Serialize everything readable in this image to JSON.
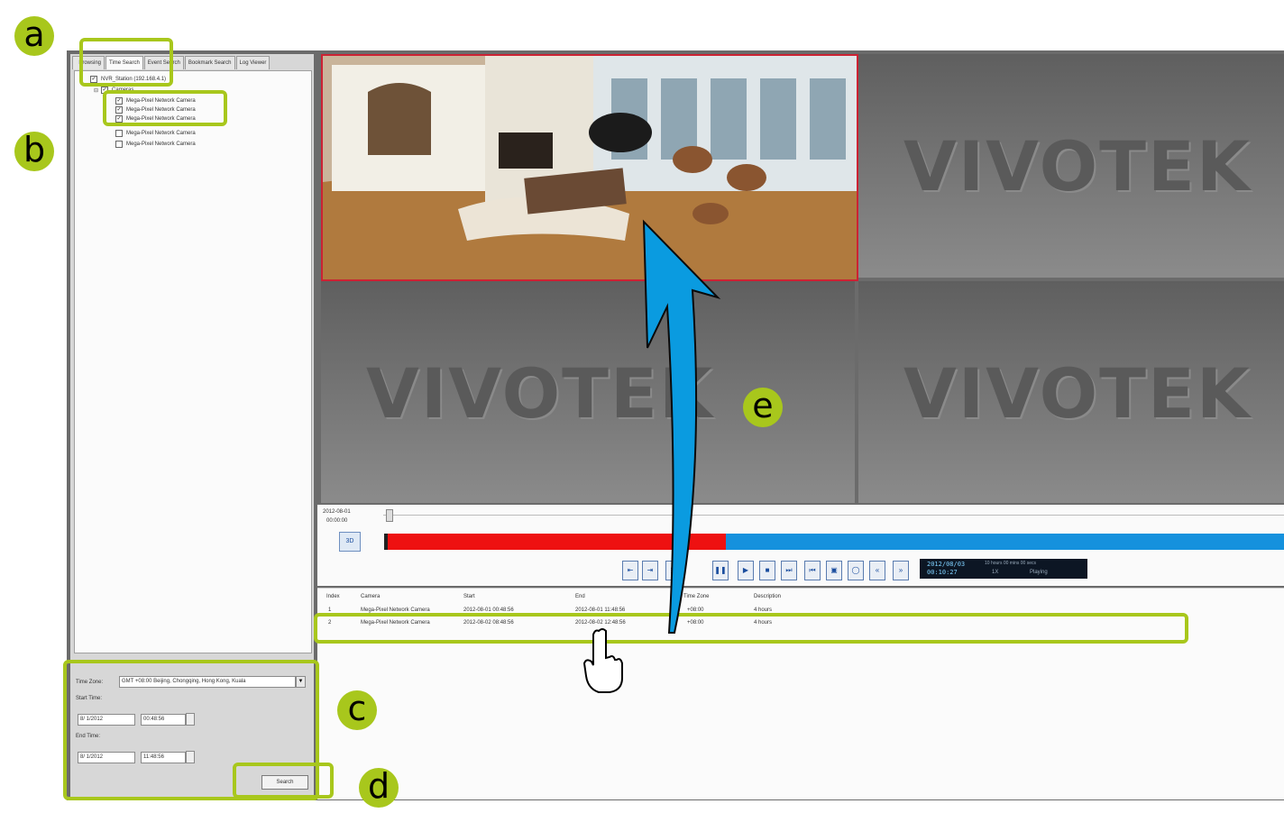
{
  "tabs": [
    "Browsing",
    "Time Search",
    "Event Search",
    "Bookmark Search",
    "Log Viewer"
  ],
  "tree": {
    "root": "NVR_Station (192.168.4.1)",
    "group": "Cameras",
    "cameras": [
      {
        "label": "Mega-Pixel Network Camera",
        "checked": true
      },
      {
        "label": "Mega-Pixel Network Camera",
        "checked": true
      },
      {
        "label": "Mega-Pixel Network Camera",
        "checked": true
      },
      {
        "label": "Mega-Pixel Network Camera",
        "checked": false
      },
      {
        "label": "Mega-Pixel Network Camera",
        "checked": false
      }
    ]
  },
  "search": {
    "timezone_label": "Time Zone:",
    "timezone_value": "GMT +08:00 Beijing, Chongqing, Hong Kong, Kuala",
    "start_label": "Start Time:",
    "start_date": "8/ 1/2012",
    "start_time": "00:48:56",
    "end_label": "End Time:",
    "end_date": "8/ 1/2012",
    "end_time": "11:48:56",
    "button": "Search"
  },
  "video": {
    "watermark": "VIVOTEK"
  },
  "timeline": {
    "date": "2012-08-01",
    "time": "00:00:00",
    "recorded_fraction": 0.38,
    "status_time": "2012/08/03",
    "status_clock": "00:10:27",
    "status_state": "Playing",
    "status_speed": "1X",
    "status_extra": "10 hours 00 mins 00 secs"
  },
  "results": {
    "headers": [
      "Index",
      "Camera",
      "Start",
      "End",
      "Time Zone",
      "Description"
    ],
    "rows": [
      [
        "1",
        "Mega-Pixel Network Camera",
        "2012-08-01 00:48:56",
        "2012-08-01 11:48:56",
        "+08:00",
        "4 hours"
      ],
      [
        "2",
        "Mega-Pixel Network Camera",
        "2012-08-02 08:48:56",
        "2012-08-02 12:48:56",
        "+08:00",
        "4 hours"
      ]
    ]
  },
  "callouts": {
    "a": "a",
    "b": "b",
    "c": "c",
    "d": "d",
    "e": "e"
  },
  "colors": {
    "accent": "#a8c71c",
    "arrow": "#0a9be0",
    "recorded": "#ee1111",
    "timeline": "#1591dd"
  }
}
